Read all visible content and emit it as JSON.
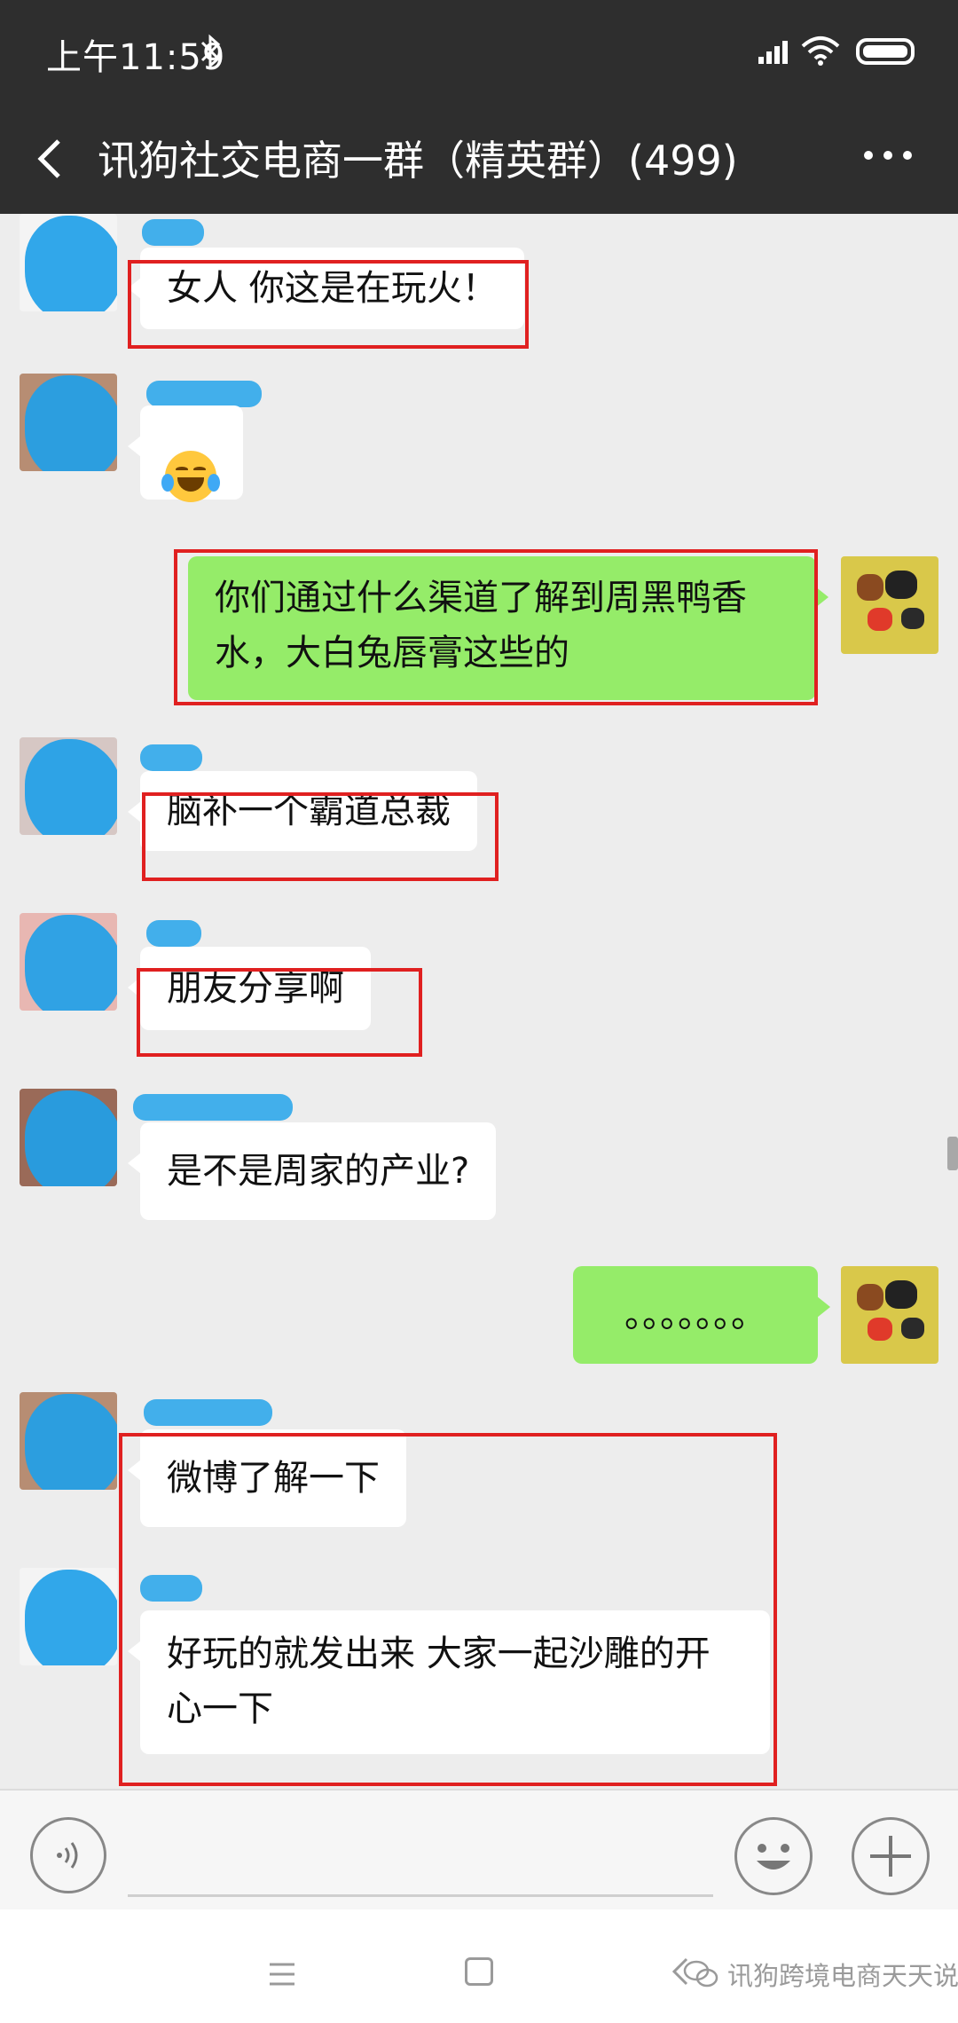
{
  "status_bar": {
    "time": "上午11:59"
  },
  "title_bar": {
    "title": "讯狗社交电商一群（精英群）(499)"
  },
  "messages": [
    {
      "side": "left",
      "text": "女人 你这是在玩火！",
      "highlighted": true
    },
    {
      "side": "left",
      "emoji": "face-with-tears-of-joy",
      "highlighted": false
    },
    {
      "side": "right",
      "lines": [
        "你们通过什么渠道了解到周黑鸭香",
        "水，大白兔唇膏这些的"
      ],
      "highlighted": true
    },
    {
      "side": "left",
      "text": "脑补一个霸道总裁",
      "highlighted": true
    },
    {
      "side": "left",
      "text": "朋友分享啊",
      "highlighted": true
    },
    {
      "side": "left",
      "text": "是不是周家的产业?",
      "highlighted": false
    },
    {
      "side": "right",
      "text": "。。。。。。。",
      "highlighted": false
    },
    {
      "side": "left",
      "text": "微博了解一下",
      "highlighted": true
    },
    {
      "side": "left",
      "lines": [
        "好玩的就发出来 大家一起沙雕的开",
        "心一下"
      ],
      "highlighted": true
    }
  ],
  "watermark": {
    "text": "讯狗跨境电商天天说"
  },
  "colors": {
    "header": "#2e2e2e",
    "chat_background": "#ededed",
    "self_bubble": "#95ec69",
    "highlight_box": "#e02020",
    "redaction": "#1fa0e8"
  },
  "icons": [
    "bluetooth-icon",
    "signal-icon",
    "wifi-icon",
    "battery-icon",
    "back-arrow-icon",
    "more-icon",
    "voice-icon",
    "emoji-icon",
    "plus-icon",
    "menu-icon",
    "home-icon",
    "back-icon",
    "wechat-icon"
  ]
}
